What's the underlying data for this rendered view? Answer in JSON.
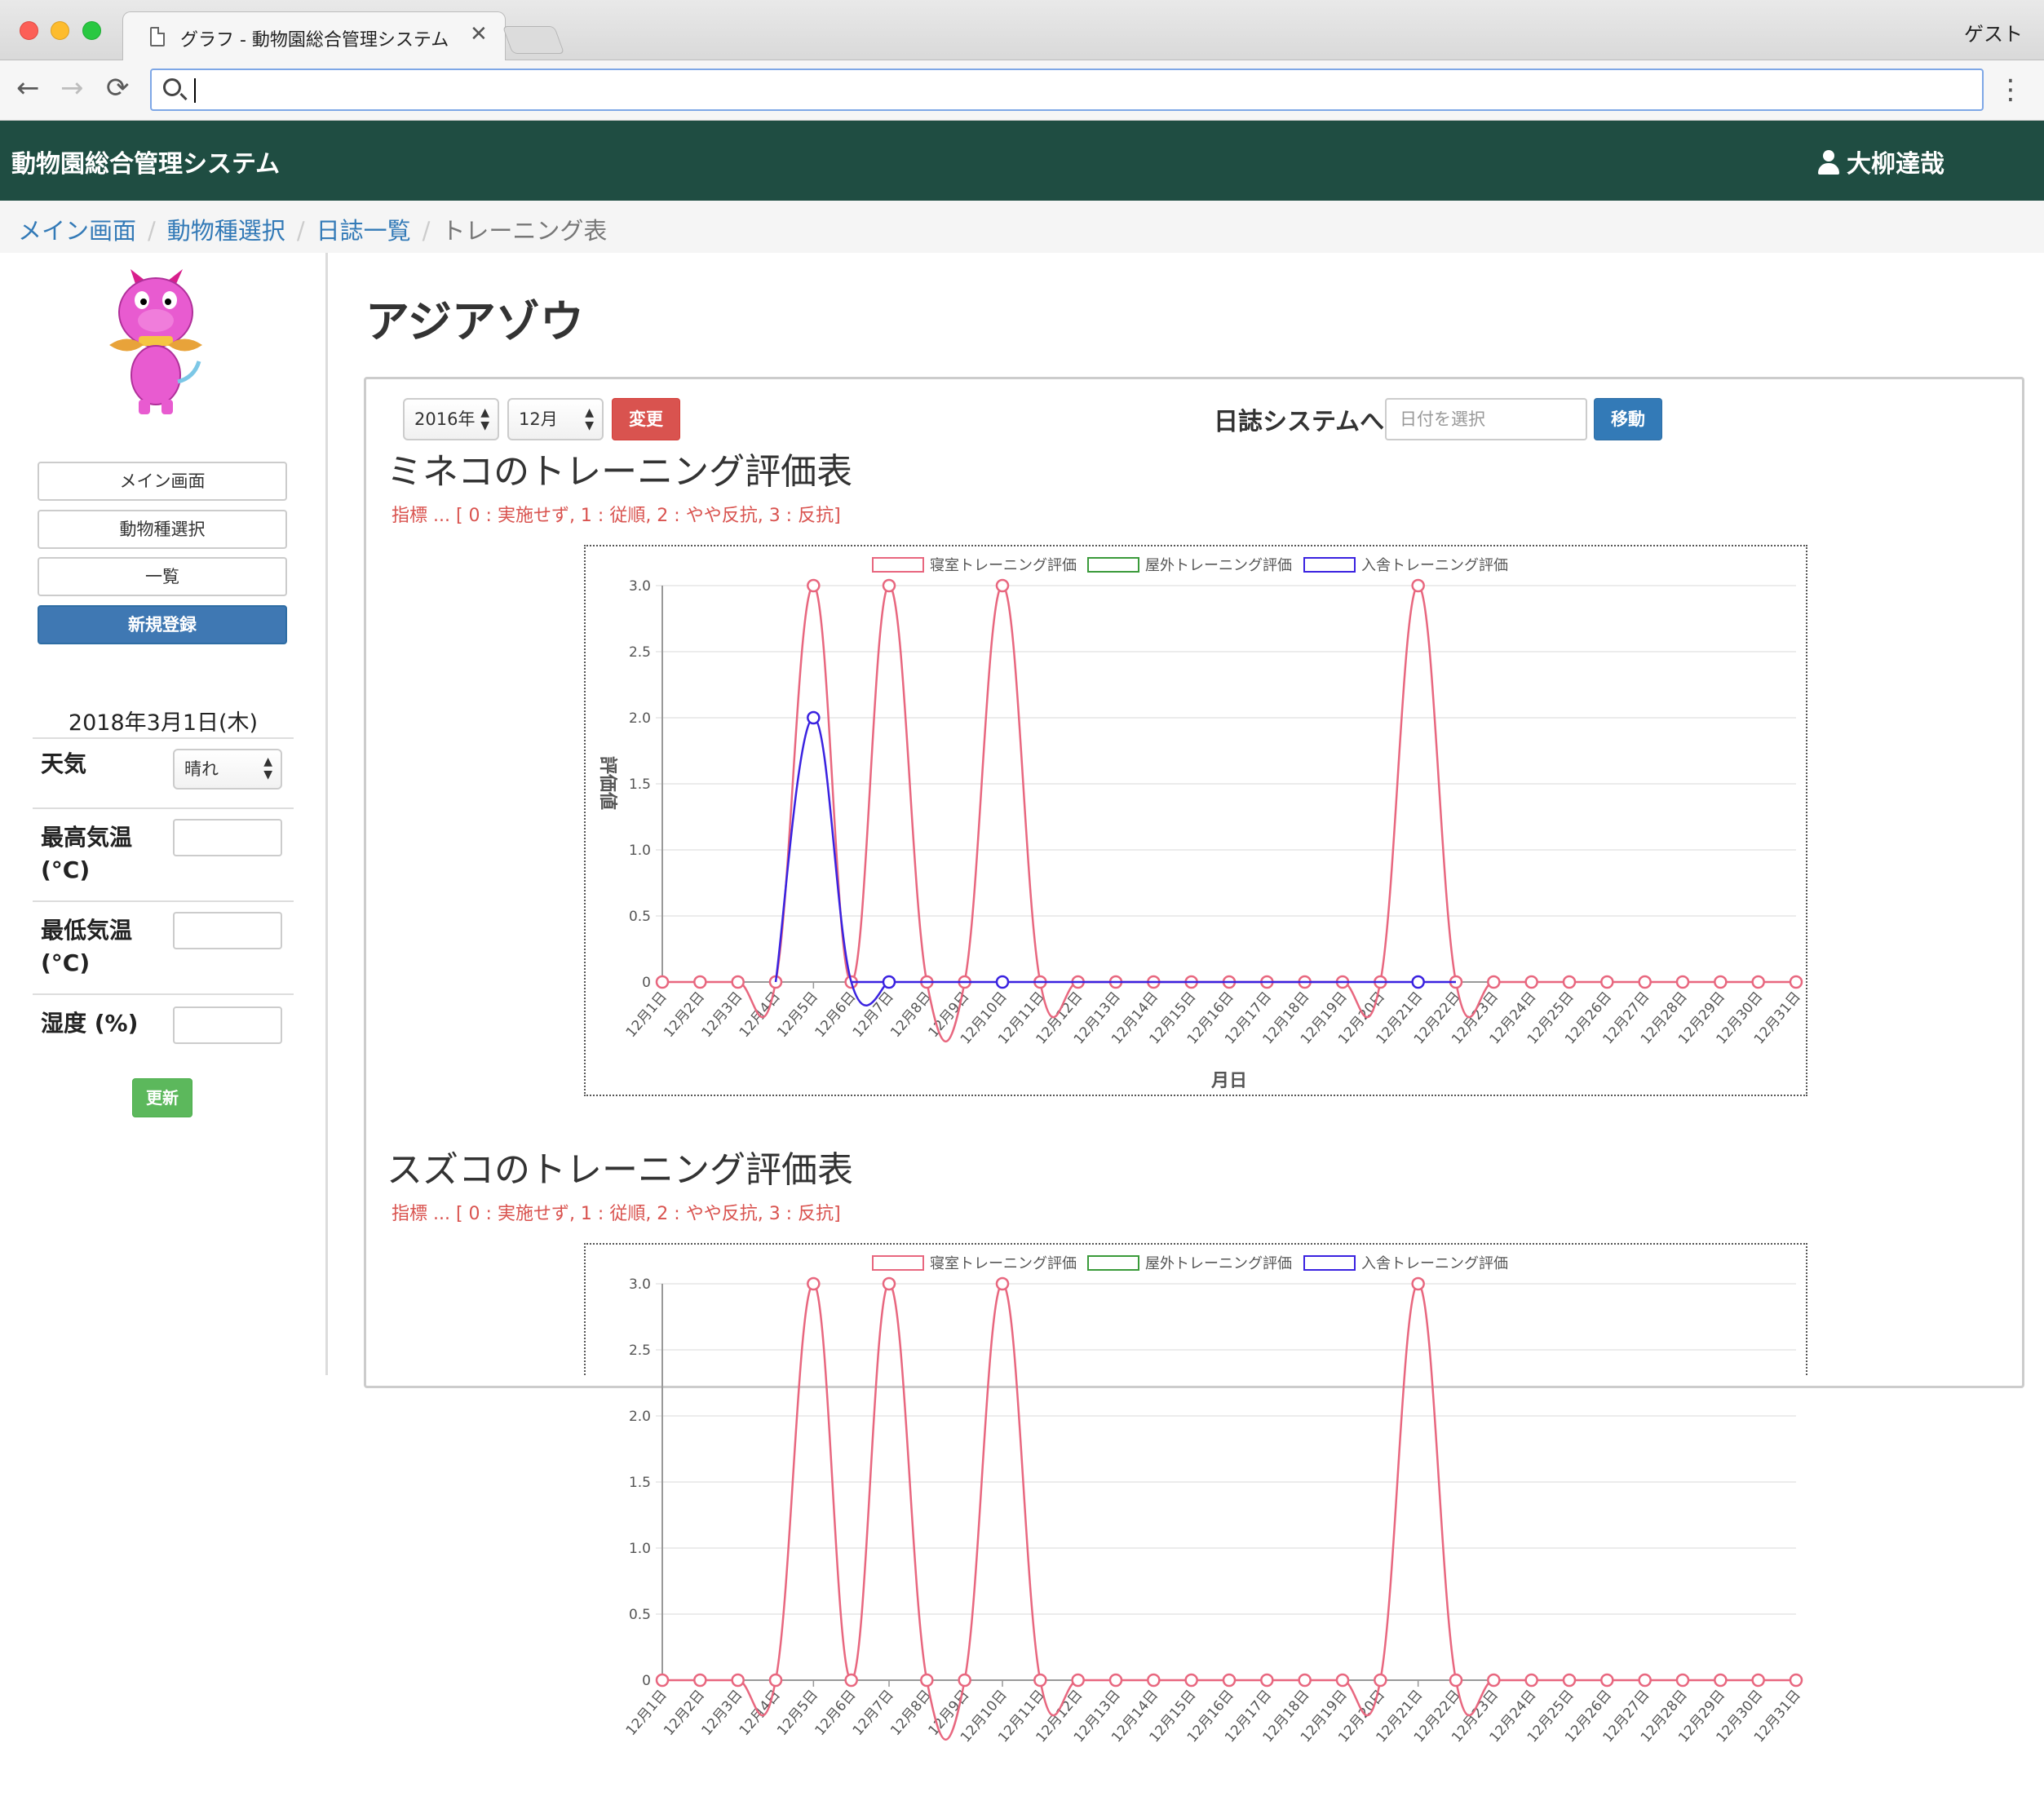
{
  "browser": {
    "tab_title": "グラフ - 動物園総合管理システム",
    "tab_close": "✕",
    "profile": "ゲスト",
    "back": "←",
    "forward": "→",
    "reload": "⟳",
    "menu": "⋮"
  },
  "navbar": {
    "brand": "動物園総合管理システム",
    "user": "大柳達哉"
  },
  "breadcrumb": {
    "items": [
      "メイン画面",
      "動物種選択",
      "日誌一覧"
    ],
    "separator": "/",
    "active": "トレーニング表"
  },
  "sidebar": {
    "buttons": [
      "メイン画面",
      "動物種選択",
      "一覧",
      "新規登録"
    ],
    "date": "2018年3月1日(木)",
    "weather_label": "天気",
    "weather_value": "晴れ",
    "max_temp_label_1": "最高気温",
    "max_temp_label_2": "(°C)",
    "min_temp_label_1": "最低気温",
    "min_temp_label_2": "(°C)",
    "humidity_label": "湿度 (%)",
    "update_button": "更新",
    "select_arrows": "▲\n▼"
  },
  "main": {
    "title": "アジアゾウ",
    "year_select": "2016年",
    "month_select": "12月",
    "change_button": "変更",
    "journal_label": "日誌システムへ",
    "date_placeholder": "日付を選択",
    "move_button": "移動",
    "index_note": "指標 ... [ 0 : 実施せず, 1 : 従順, 2 : やや反抗, 3 : 反抗]"
  },
  "charts_meta": [
    {
      "title": "ミネコのトレーニング評価表"
    },
    {
      "title": "スズコのトレーニング評価表"
    }
  ],
  "colors": {
    "bedroom": "#e8677f",
    "outdoor": "#3a9a3a",
    "entry": "#3a22e0"
  },
  "chart_data": [
    {
      "type": "line",
      "title": "",
      "xlabel": "月日",
      "ylabel": "評価値",
      "ylim": [
        0,
        3.0
      ],
      "yticks": [
        "0",
        "0.5",
        "1.0",
        "1.5",
        "2.0",
        "2.5",
        "3.0"
      ],
      "legend_position": "top",
      "categories": [
        "12月1日",
        "12月2日",
        "12月3日",
        "12月4日",
        "12月5日",
        "12月6日",
        "12月7日",
        "12月8日",
        "12月9日",
        "12月10日",
        "12月11日",
        "12月12日",
        "12月13日",
        "12月14日",
        "12月15日",
        "12月16日",
        "12月17日",
        "12月18日",
        "12月19日",
        "12月20日",
        "12月21日",
        "12月22日",
        "12月23日",
        "12月24日",
        "12月25日",
        "12月26日",
        "12月27日",
        "12月28日",
        "12月29日",
        "12月30日",
        "12月31日"
      ],
      "series": [
        {
          "name": "寝室トレーニング評価",
          "values": [
            0,
            0,
            0,
            0,
            3,
            0,
            3,
            0,
            0,
            3,
            0,
            0,
            0,
            0,
            0,
            0,
            0,
            0,
            0,
            0,
            3,
            0,
            0,
            0,
            0,
            0,
            0,
            0,
            0,
            0,
            0
          ]
        },
        {
          "name": "屋外トレーニング評価",
          "values": []
        },
        {
          "name": "入舎トレーニング評価",
          "values": [
            null,
            null,
            null,
            null,
            2,
            null,
            0,
            null,
            null,
            0,
            null,
            null,
            null,
            null,
            null,
            null,
            null,
            null,
            null,
            null,
            0,
            null,
            null,
            null,
            null,
            null,
            null,
            null,
            null,
            null,
            null
          ]
        }
      ]
    },
    {
      "type": "line",
      "title": "",
      "xlabel": "",
      "ylabel": "",
      "ylim": [
        0,
        3.0
      ],
      "yticks": [
        "0",
        "0.5",
        "1.0",
        "1.5",
        "2.0",
        "2.5",
        "3.0"
      ],
      "legend_position": "top",
      "categories": [
        "12月1日",
        "12月2日",
        "12月3日",
        "12月4日",
        "12月5日",
        "12月6日",
        "12月7日",
        "12月8日",
        "12月9日",
        "12月10日",
        "12月11日",
        "12月12日",
        "12月13日",
        "12月14日",
        "12月15日",
        "12月16日",
        "12月17日",
        "12月18日",
        "12月19日",
        "12月20日",
        "12月21日",
        "12月22日",
        "12月23日",
        "12月24日",
        "12月25日",
        "12月26日",
        "12月27日",
        "12月28日",
        "12月29日",
        "12月30日",
        "12月31日"
      ],
      "series": [
        {
          "name": "寝室トレーニング評価",
          "values": [
            0,
            0,
            0,
            0,
            3,
            0,
            3,
            0,
            0,
            3,
            0,
            0,
            0,
            0,
            0,
            0,
            0,
            0,
            0,
            0,
            3,
            0,
            0,
            0,
            0,
            0,
            0,
            0,
            0,
            0,
            0
          ]
        },
        {
          "name": "屋外トレーニング評価",
          "values": []
        },
        {
          "name": "入舎トレーニング評価",
          "values": []
        }
      ]
    }
  ]
}
